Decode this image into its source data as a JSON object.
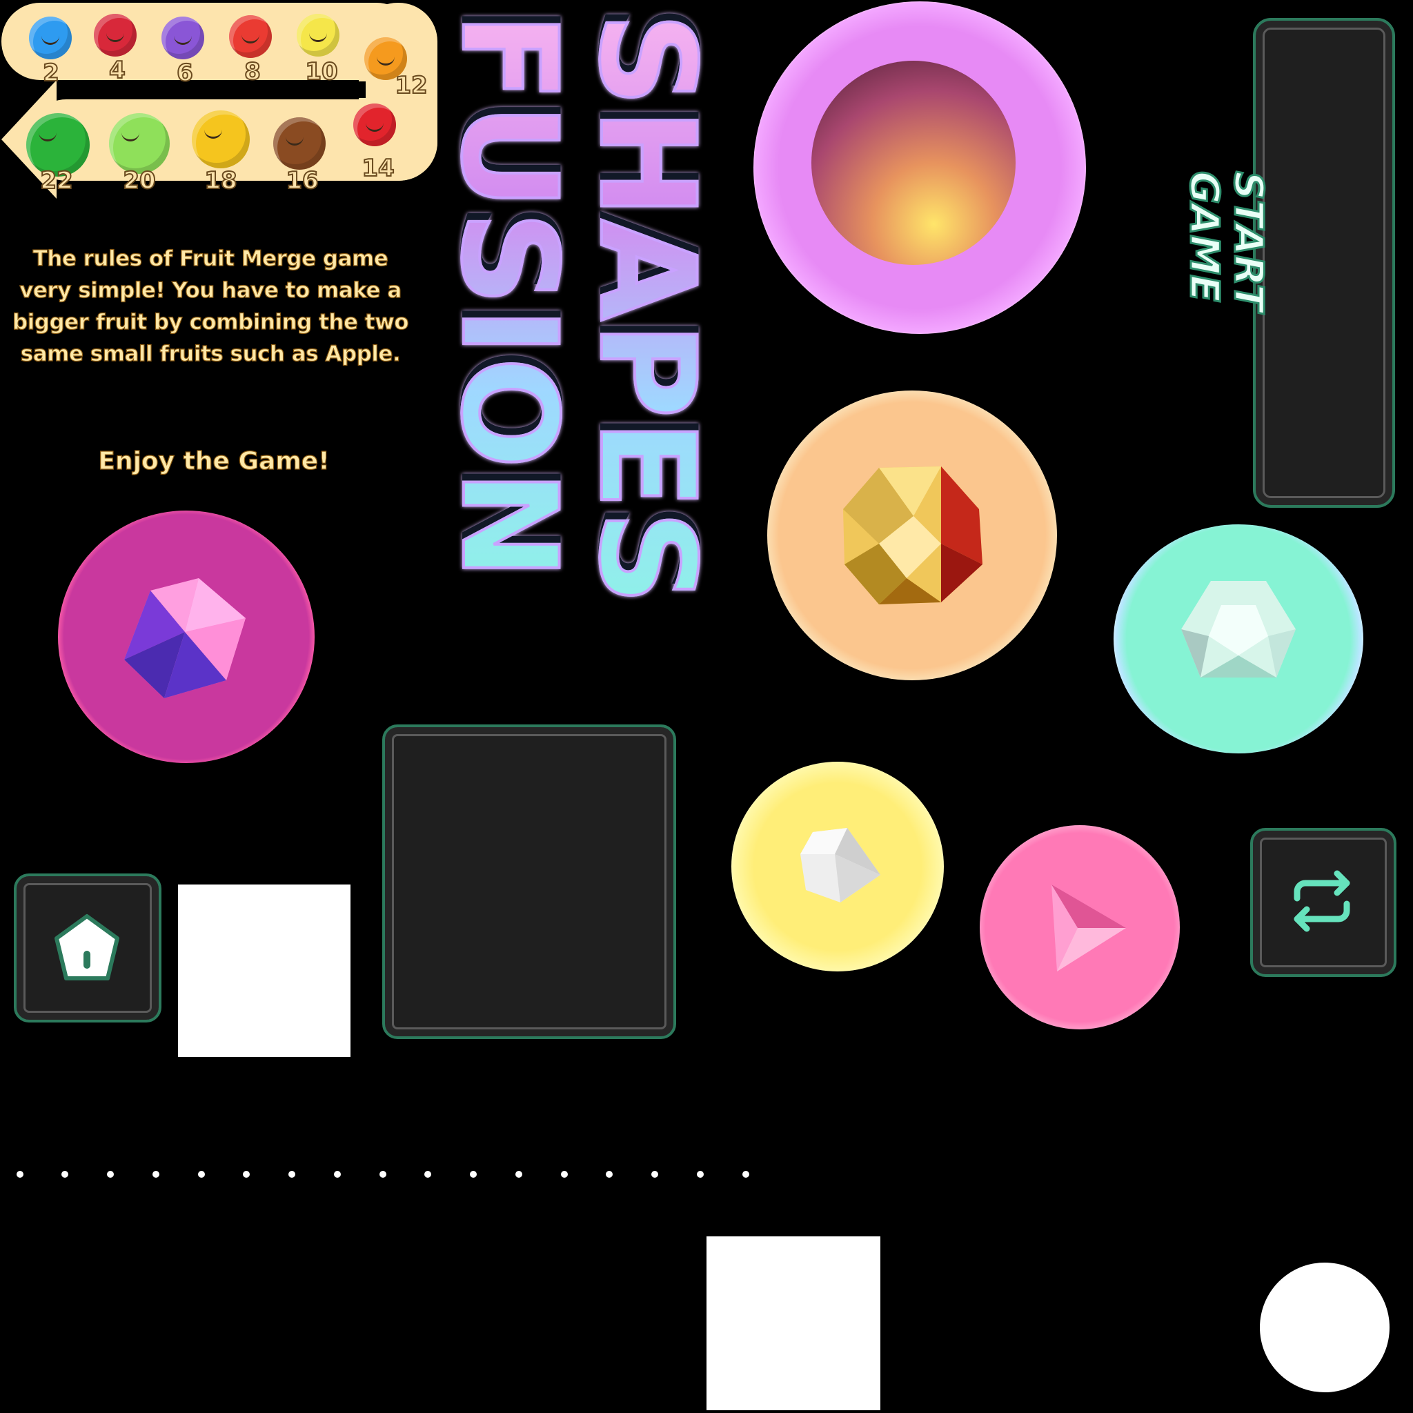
{
  "fruit_chain": [
    {
      "name": "blueberry",
      "value": "2",
      "color": "#2e9bf0"
    },
    {
      "name": "cherry",
      "value": "4",
      "color": "#d8283a"
    },
    {
      "name": "grape",
      "value": "6",
      "color": "#8a56d6"
    },
    {
      "name": "strawberry",
      "value": "8",
      "color": "#ea3b32"
    },
    {
      "name": "lemon",
      "value": "10",
      "color": "#f5e64a"
    },
    {
      "name": "orange",
      "value": "12",
      "color": "#f59a1e"
    },
    {
      "name": "apple",
      "value": "14",
      "color": "#e2242c"
    },
    {
      "name": "coconut",
      "value": "16",
      "color": "#8a4b22"
    },
    {
      "name": "pineapple",
      "value": "18",
      "color": "#f5c51e"
    },
    {
      "name": "melon",
      "value": "20",
      "color": "#8fe05a"
    },
    {
      "name": "watermelon",
      "value": "22",
      "color": "#2bb33a"
    }
  ],
  "rules": {
    "line1": "The rules of Fruit Merge game",
    "line2": "very simple! You have to make a",
    "line3": "bigger fruit by combining the two",
    "line4": "same small fruits such as Apple.",
    "enjoy": "Enjoy the Game!"
  },
  "title": {
    "line1": "SHAPES",
    "line2": "FUSION"
  },
  "start_button": {
    "line1": "START",
    "line2": "GAME"
  },
  "icons": {
    "home": "home-icon",
    "replay": "replay-icon",
    "play": "play-arrow-icon"
  },
  "colors": {
    "panel_border": "#2c7a5c",
    "panel_fill": "#1f1f1f",
    "title_gradient_start": "#f6b3f0",
    "title_gradient_end": "#8ff1e8"
  }
}
